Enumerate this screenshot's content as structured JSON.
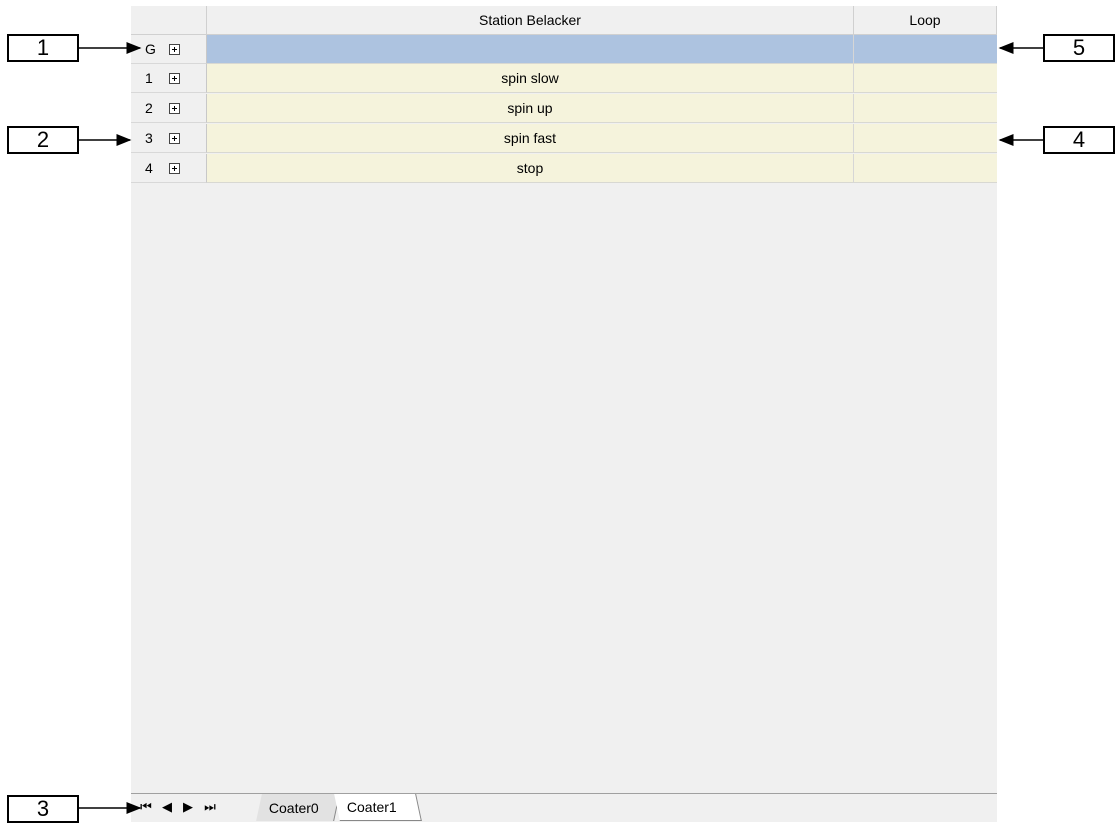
{
  "grid": {
    "headers": [
      "",
      "Station Belacker",
      "Loop"
    ],
    "rows": [
      {
        "label": "G",
        "step": "",
        "loop": ""
      },
      {
        "label": "1",
        "step": "spin slow",
        "loop": ""
      },
      {
        "label": "2",
        "step": "spin up",
        "loop": ""
      },
      {
        "label": "3",
        "step": "spin fast",
        "loop": ""
      },
      {
        "label": "4",
        "step": "stop",
        "loop": ""
      }
    ]
  },
  "tabs": {
    "nav": [
      "⏮",
      "◀",
      "▶",
      "⏭"
    ],
    "items": [
      "Coater0",
      "Coater1"
    ],
    "active": "Coater1"
  },
  "callouts": [
    "1",
    "2",
    "3",
    "4",
    "5"
  ],
  "colors": {
    "selected_row": "#adc3e0",
    "data_row": "#f5f3dc",
    "background": "#f0f0f0"
  }
}
